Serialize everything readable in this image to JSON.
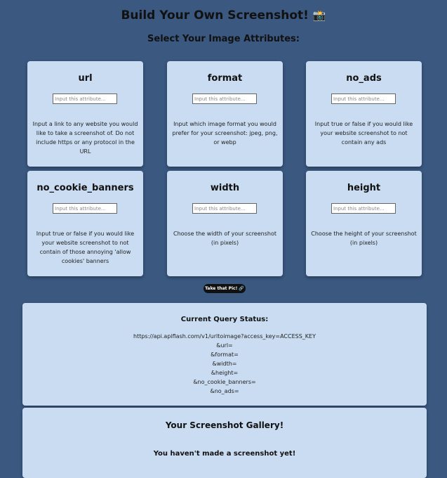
{
  "header": {
    "title": "Build Your Own Screenshot!",
    "title_icon": "📸",
    "subtitle": "Select Your Image Attributes:"
  },
  "attributes": [
    {
      "name": "url",
      "placeholder": "Input this attribute...",
      "description": "Input a link to any website you would like to take a screenshot of. Do not include https or any protocol in the URL"
    },
    {
      "name": "format",
      "placeholder": "Input this attribute...",
      "description": "Input which image format you would prefer for your screenshot: jpeg, png, or webp"
    },
    {
      "name": "no_ads",
      "placeholder": "Input this attribute...",
      "description": "Input true or false if you would like your website screenshot to not contain any ads"
    },
    {
      "name": "no_cookie_banners",
      "placeholder": "Input this attribute...",
      "description": "Input true or false if you would like your website screenshot to not contain of those annoying 'allow cookies' banners"
    },
    {
      "name": "width",
      "placeholder": "Input this attribute...",
      "description": "Choose the width of your screenshot (in pixels)"
    },
    {
      "name": "height",
      "placeholder": "Input this attribute...",
      "description": "Choose the height of your screenshot (in pixels)"
    }
  ],
  "submit_button": {
    "label": "Take that Pic! 🔗"
  },
  "query_status": {
    "heading": "Current Query Status:",
    "lines": [
      "https://api.apiflash.com/v1/urltoimage?access_key=ACCESS_KEY",
      "&url=",
      "&format=",
      "&width=",
      "&height=",
      "&no_cookie_banners=",
      "&no_ads="
    ]
  },
  "gallery": {
    "heading": "Your Screenshot Gallery!",
    "empty_message": "You haven't made a screenshot yet!"
  }
}
